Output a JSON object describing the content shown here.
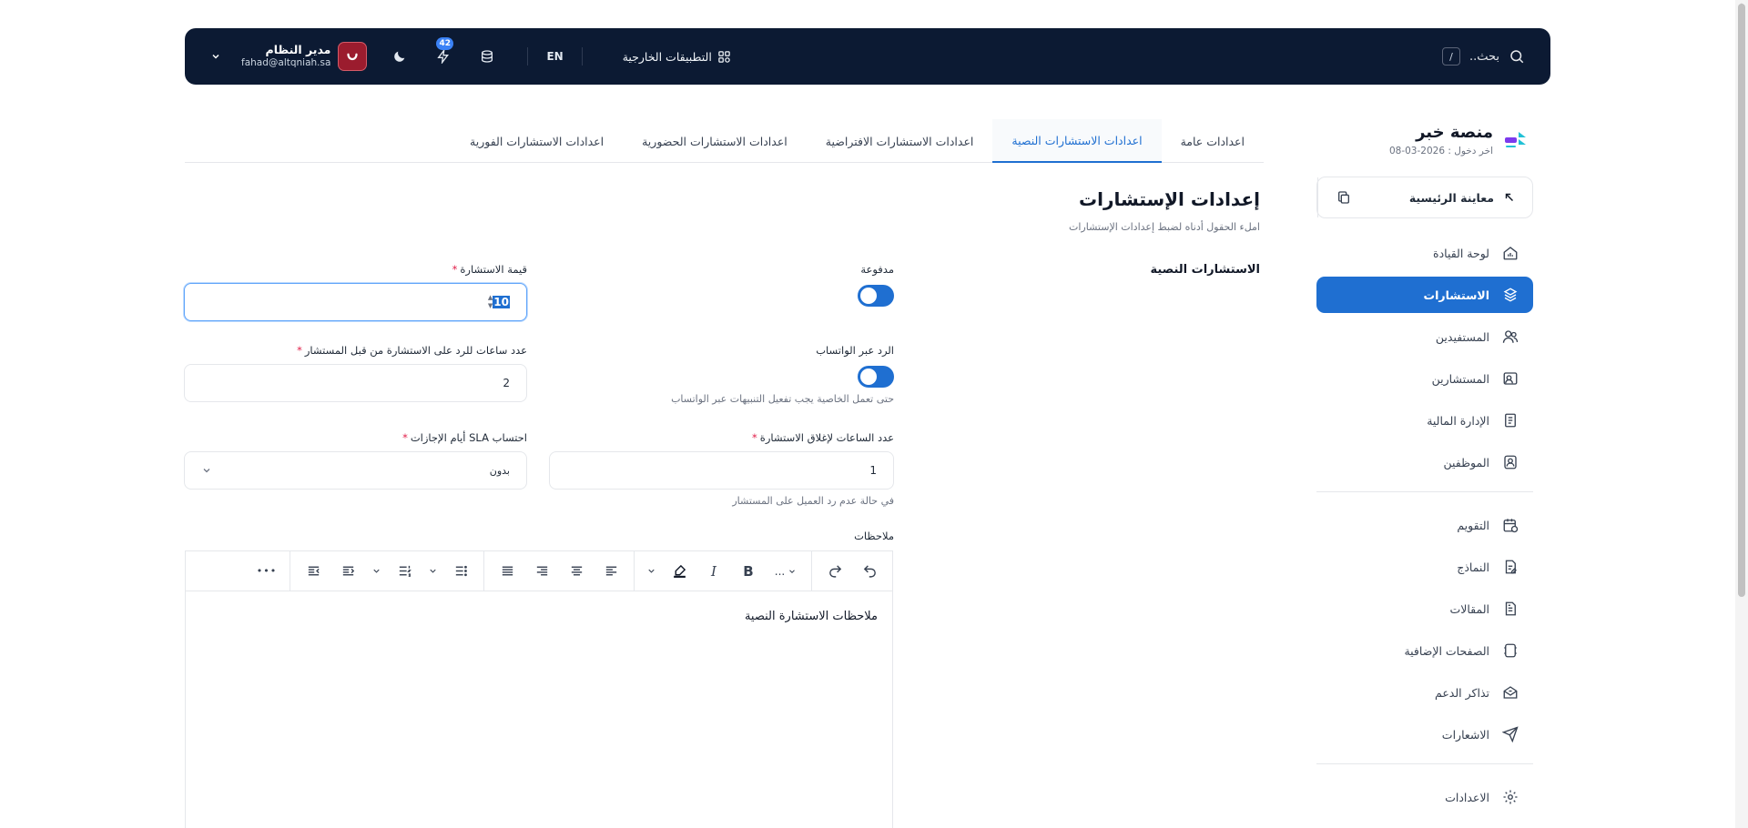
{
  "topbar": {
    "search_label": "بحث..",
    "search_shortcut": "/",
    "external_apps_label": "التطبيقات الخارجية",
    "language_label": "EN",
    "notifications_count": "42",
    "user_name": "مدير النظام",
    "user_email": "fahad@altqniah.sa"
  },
  "sidebar": {
    "brand_name": "منصة خبر",
    "last_login": "اخر دخول : 2026-03-08",
    "preview_label": "معاينة الرئيسية",
    "items": [
      {
        "label": "لوحة القيادة",
        "icon": "dashboard-icon"
      },
      {
        "label": "الاستشارات",
        "icon": "consultations-icon",
        "active": true
      },
      {
        "label": "المستفيدين",
        "icon": "users-icon"
      },
      {
        "label": "المستشارين",
        "icon": "consultants-icon"
      },
      {
        "label": "الإدارة المالية",
        "icon": "finance-icon"
      },
      {
        "label": "الموظفين",
        "icon": "employees-icon"
      },
      {
        "label": "التقويم",
        "icon": "calendar-icon"
      },
      {
        "label": "النماذج",
        "icon": "forms-icon"
      },
      {
        "label": "المقالات",
        "icon": "articles-icon"
      },
      {
        "label": "الصفحات الإضافية",
        "icon": "pages-icon"
      },
      {
        "label": "تذاكر الدعم",
        "icon": "support-icon"
      },
      {
        "label": "الاشعارات",
        "icon": "send-icon"
      },
      {
        "label": "الاعدادات",
        "icon": "gear-icon"
      }
    ]
  },
  "tabs": [
    {
      "label": "اعدادات عامة"
    },
    {
      "label": "اعدادات الاستشارات النصية",
      "active": true
    },
    {
      "label": "اعدادات الاستشارات الافتراضية"
    },
    {
      "label": "اعدادات الاستشارات الحضورية"
    },
    {
      "label": "اعدادات الاستشارات الفورية"
    }
  ],
  "section": {
    "title": "إعدادات الإستشارات",
    "subtitle": "املء الحقول أدناه لضبط إعدادات الإستشارات",
    "group_label": "الاستشارات النصية"
  },
  "fields": {
    "paid_label": "مدفوعة",
    "paid_on": true,
    "price_label": "قيمة الاستشارة",
    "price_value": "10",
    "whatsapp_label": "الرد عبر الواتساب",
    "whatsapp_on": true,
    "whatsapp_hint": "حتى تعمل الخاصية يجب تفعيل التنبيهات عبر الواتساب",
    "reply_hours_label": "عدد ساعات للرد على الاستشارة من قبل المستشار",
    "reply_hours_value": "2",
    "close_hours_label": "عدد الساعات لإغلاق الاستشارة",
    "close_hours_value": "1",
    "close_hours_hint": "في حالة عدم رد العميل على المستشار",
    "sla_label": "احتساب SLA أيام الإجازات",
    "sla_value": "بدون",
    "required_mark": "*"
  },
  "editor": {
    "label": "ملاحظات",
    "content": "ملاحظات الاستشارة النصية",
    "font_select_label": "...",
    "bold_label": "B",
    "italic_label": "I",
    "more_label": "•••"
  },
  "colors": {
    "navbar_bg": "#0c1a33",
    "accent": "#1f6fd1",
    "avatar_bg": "#9b1c2e",
    "required": "#e11d48"
  }
}
